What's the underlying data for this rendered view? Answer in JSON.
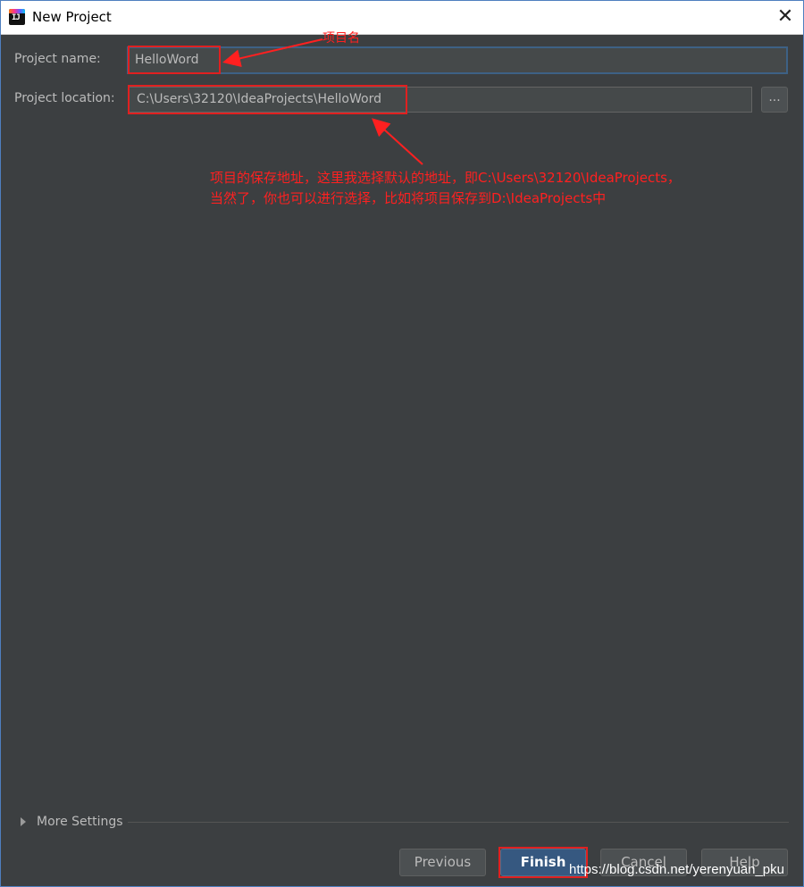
{
  "window": {
    "title": "New Project"
  },
  "form": {
    "project_name_label": "Project name:",
    "project_name_value": "HelloWord",
    "project_location_label": "Project location:",
    "project_location_value": "C:\\Users\\32120\\IdeaProjects\\HelloWord",
    "browse_label": "..."
  },
  "annotations": {
    "name_note": "项目名",
    "location_note_line1": "项目的保存地址，这里我选择默认的地址，即C:\\Users\\32120\\IdeaProjects，",
    "location_note_line2": "当然了，你也可以进行选择，比如将项目保存到D:\\IdeaProjects中",
    "annotation_color": "#ff2020"
  },
  "more_settings": {
    "label": "More Settings"
  },
  "buttons": {
    "previous": "Previous",
    "finish": "Finish",
    "cancel": "Cancel",
    "help": "Help"
  },
  "watermark": "https://blog.csdn.net/yerenyuan_pku",
  "colors": {
    "background": "#3c3f41",
    "field": "#45494a",
    "focus_border": "#3d6185",
    "primary_button": "#365880"
  }
}
